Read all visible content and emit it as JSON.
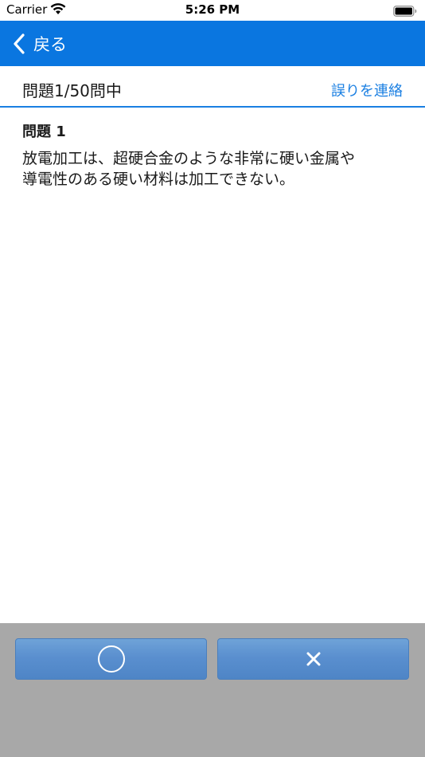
{
  "status_bar": {
    "carrier": "Carrier",
    "time": "5:26 PM",
    "wifi_icon": "wifi-icon",
    "battery_icon": "battery-icon"
  },
  "nav": {
    "back_label": "戻る",
    "back_icon": "chevron-left-icon",
    "bar_color": "#0a76e0"
  },
  "header": {
    "progress": "問題1/50問中",
    "report_link": "誤りを連絡",
    "link_color": "#1a7fe2"
  },
  "question": {
    "title": "問題 1",
    "line1": "放電加工は、超硬合金のような非常に硬い金属や",
    "line2": "導電性のある硬い材料は加工できない。"
  },
  "answers": {
    "true_icon": "circle-icon",
    "false_icon": "cross-icon",
    "panel_color": "#a8a8a8",
    "button_color": "#5a8fcf"
  }
}
